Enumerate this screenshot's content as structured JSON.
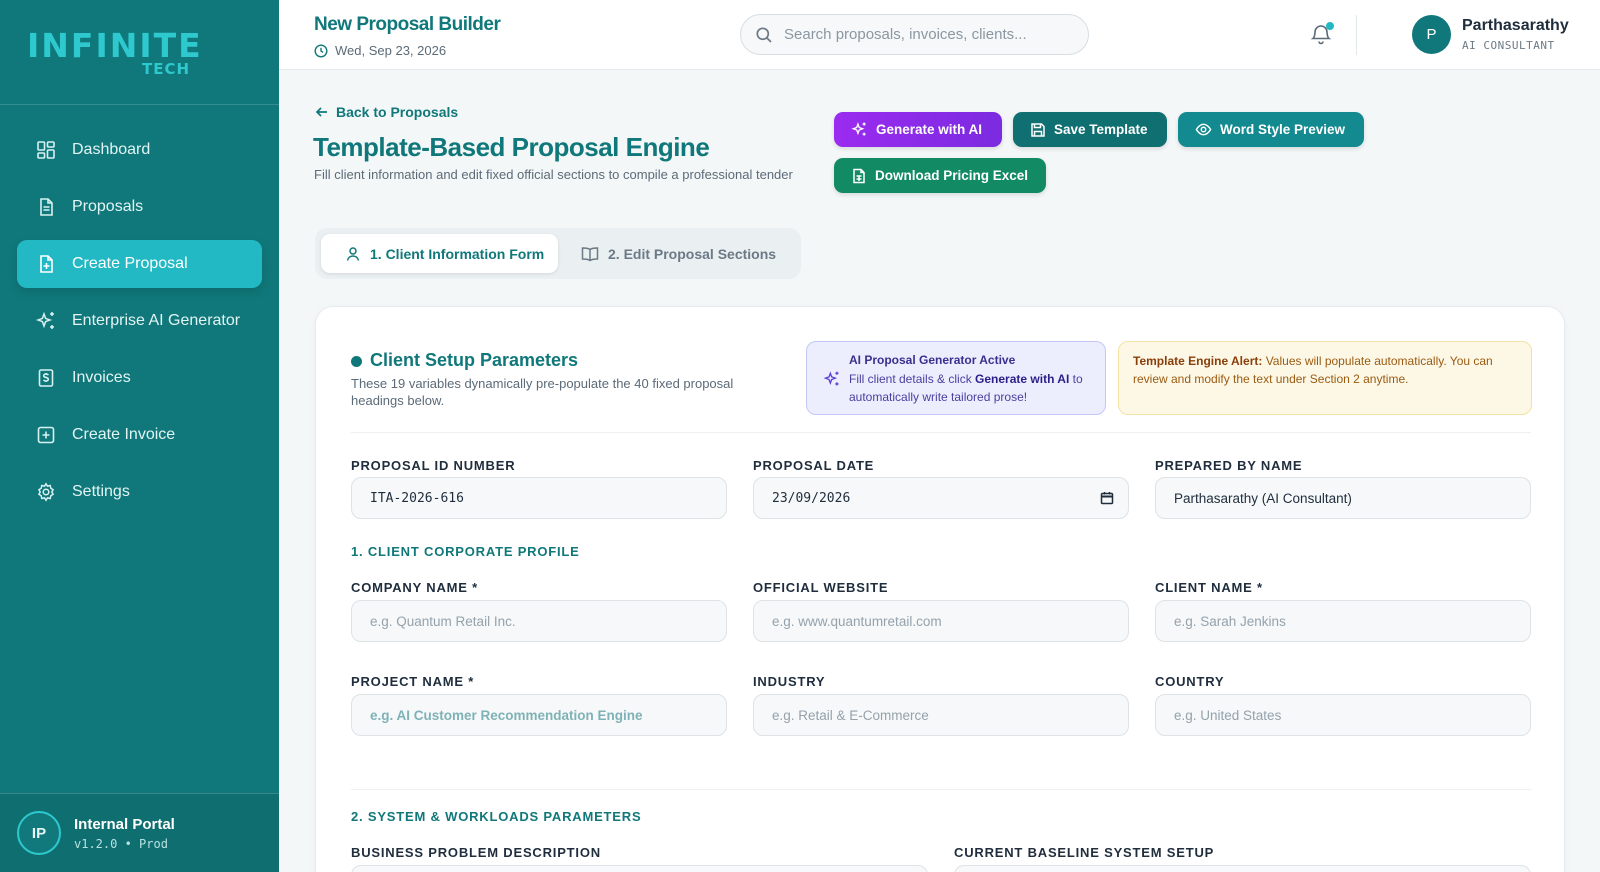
{
  "brand": {
    "logo_text": "INFINITE",
    "logo_sub": "TECH"
  },
  "sidebar": {
    "items": [
      {
        "label": "Dashboard",
        "icon": "dashboard-icon"
      },
      {
        "label": "Proposals",
        "icon": "document-icon"
      },
      {
        "label": "Create Proposal",
        "icon": "file-plus-icon",
        "active": true
      },
      {
        "label": "Enterprise AI Generator",
        "icon": "sparkles-icon"
      },
      {
        "label": "Invoices",
        "icon": "dollar-receipt-icon"
      },
      {
        "label": "Create Invoice",
        "icon": "plus-square-icon"
      },
      {
        "label": "Settings",
        "icon": "gear-icon"
      }
    ],
    "footer": {
      "initials": "IP",
      "title": "Internal Portal",
      "version": "v1.2.0 • Prod"
    }
  },
  "header": {
    "title": "New Proposal Builder",
    "date": "Wed, Sep 23, 2026",
    "search_placeholder": "Search proposals, invoices, clients...",
    "user": {
      "initial": "P",
      "name": "Parthasarathy",
      "role": "AI CONSULTANT"
    }
  },
  "page": {
    "back_label": "Back to Proposals",
    "title": "Template-Based Proposal Engine",
    "subtitle": "Fill client information and edit fixed official sections to compile a professional tender",
    "buttons": {
      "generate_ai": "Generate with AI",
      "save_template": "Save Template",
      "word_preview": "Word Style Preview",
      "download_excel": "Download Pricing Excel"
    },
    "tabs": [
      {
        "label": "1. Client Information Form",
        "active": true
      },
      {
        "label": "2. Edit Proposal Sections",
        "active": false
      }
    ]
  },
  "form": {
    "section_title": "Client Setup Parameters",
    "section_sub": "These 19 variables dynamically pre-populate the 40 fixed proposal headings below.",
    "ai_notice": {
      "title": "AI Proposal Generator Active",
      "text_pre": "Fill client details & click ",
      "text_bold": "Generate with AI",
      "text_post": " to automatically write tailored prose!"
    },
    "alert": {
      "title": "Template Engine Alert:",
      "text": " Values will populate automatically. You can review and modify the text under Section 2 anytime."
    },
    "fields": {
      "proposal_id": {
        "label": "PROPOSAL ID NUMBER",
        "value": "ITA-2026-616"
      },
      "proposal_date": {
        "label": "PROPOSAL DATE",
        "value": "23/09/2026"
      },
      "prepared_by": {
        "label": "PREPARED BY NAME",
        "value": "Parthasarathy (AI Consultant)"
      }
    },
    "group1": {
      "title": "1. CLIENT CORPORATE PROFILE",
      "company": {
        "label": "COMPANY NAME *",
        "placeholder": "e.g. Quantum Retail Inc."
      },
      "website": {
        "label": "OFFICIAL WEBSITE",
        "placeholder": "e.g. www.quantumretail.com"
      },
      "client": {
        "label": "CLIENT NAME *",
        "placeholder": "e.g. Sarah Jenkins"
      },
      "project": {
        "label": "PROJECT NAME *",
        "placeholder": "e.g. AI Customer Recommendation Engine"
      },
      "industry": {
        "label": "INDUSTRY",
        "placeholder": "e.g. Retail & E-Commerce"
      },
      "country": {
        "label": "COUNTRY",
        "placeholder": "e.g. United States"
      }
    },
    "group2": {
      "title": "2. SYSTEM & WORKLOADS PARAMETERS",
      "problem": {
        "label": "BUSINESS PROBLEM DESCRIPTION"
      },
      "baseline": {
        "label": "CURRENT BASELINE SYSTEM SETUP"
      }
    }
  },
  "colors": {
    "primary": "#10787a",
    "accent": "#23b9c4",
    "ai_purple": "#8a2be2",
    "excel_green": "#128a63"
  }
}
